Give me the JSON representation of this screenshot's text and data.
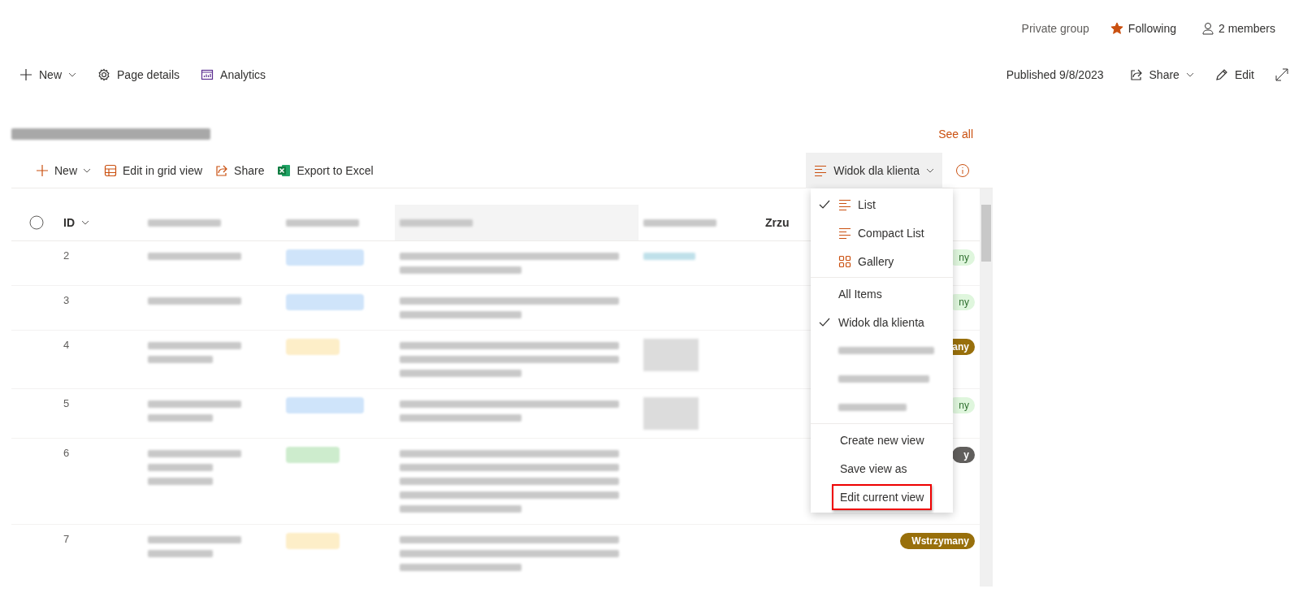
{
  "header": {
    "privacy": "Private group",
    "follow": {
      "label": "Following",
      "on": true
    },
    "members": "2 members"
  },
  "command_bar": {
    "left": [
      {
        "kind": "new",
        "label": "New"
      },
      {
        "kind": "details",
        "label": "Page details"
      },
      {
        "kind": "analytics",
        "label": "Analytics"
      }
    ],
    "published": "Published 9/8/2023",
    "right": [
      {
        "kind": "share",
        "label": "Share"
      },
      {
        "kind": "edit",
        "label": "Edit"
      }
    ]
  },
  "webpart": {
    "see_all": "See all",
    "toolbar": [
      {
        "kind": "new",
        "label": "New"
      },
      {
        "kind": "grid",
        "label": "Edit in grid view"
      },
      {
        "kind": "share",
        "label": "Share"
      },
      {
        "kind": "excel",
        "label": "Export to Excel"
      }
    ],
    "view_button": "Widok dla klienta"
  },
  "table": {
    "select_all": {
      "checked": false
    },
    "columns": [
      {
        "kind": "text",
        "label": "ID"
      },
      {
        "kind": "blurred"
      },
      {
        "kind": "blurred"
      },
      {
        "kind": "blurred"
      },
      {
        "kind": "blurred"
      },
      {
        "kind": "text",
        "label": "Zrzu"
      }
    ],
    "rows": [
      {
        "id": "2",
        "tag": {
          "color": "#cfe4fa"
        },
        "attachment": {
          "kind": "link"
        },
        "status": {
          "kind": "done",
          "text": "ny"
        }
      },
      {
        "id": "3",
        "tag": {
          "color": "#cfe4fa"
        },
        "status": {
          "kind": "done",
          "text": "ny"
        }
      },
      {
        "id": "4",
        "tag": {
          "color": "#fdeec8"
        },
        "attachment": {
          "kind": "image"
        },
        "status": {
          "kind": "paused",
          "text": "any"
        }
      },
      {
        "id": "5",
        "tag": {
          "color": "#cfe4fa"
        },
        "attachment": {
          "kind": "image"
        },
        "status": {
          "kind": "done",
          "text": "ny"
        }
      },
      {
        "id": "6",
        "tag": {
          "color": "#cdeccd"
        },
        "status": {
          "kind": "other",
          "text": "y"
        }
      },
      {
        "id": "7",
        "tag": {
          "color": "#fdeec8"
        },
        "status": {
          "kind": "paused",
          "text": "Wstrzymany"
        }
      }
    ]
  },
  "view_menu": {
    "layouts": [
      {
        "kind": "list",
        "label": "List",
        "selected": true
      },
      {
        "kind": "compact",
        "label": "Compact List",
        "selected": false
      },
      {
        "kind": "gallery",
        "label": "Gallery",
        "selected": false
      }
    ],
    "views": [
      {
        "kind": "text",
        "label": "All Items",
        "selected": false
      },
      {
        "kind": "text",
        "label": "Widok dla klienta",
        "selected": true
      },
      {
        "kind": "blurred",
        "selected": false
      },
      {
        "kind": "blurred",
        "selected": false
      },
      {
        "kind": "blurred",
        "selected": false
      }
    ],
    "actions": [
      {
        "label": "Create new view",
        "highlighted": false
      },
      {
        "label": "Save view as",
        "highlighted": false
      },
      {
        "label": "Edit current view",
        "highlighted": true
      }
    ]
  }
}
